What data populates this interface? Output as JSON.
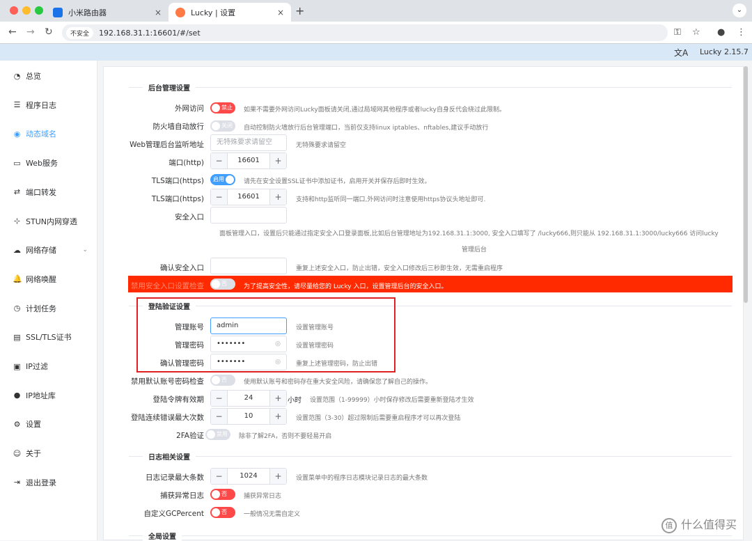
{
  "browser": {
    "tabs": [
      {
        "label": "小米路由器",
        "close": "×"
      },
      {
        "label": "Lucky | 设置",
        "close": "×"
      }
    ],
    "new_tab": "+",
    "expand": "⌄",
    "insecure": "不安全",
    "url": "192.168.31.1:16601/#/set"
  },
  "header": {
    "lang_icon": "文A",
    "version": "Lucky 2.15.7"
  },
  "sidebar": {
    "items": [
      {
        "label": "总览",
        "icon": "dashboard-icon"
      },
      {
        "label": "程序日志",
        "icon": "log-icon"
      },
      {
        "label": "动态域名",
        "icon": "ddns-icon"
      },
      {
        "label": "Web服务",
        "icon": "web-icon"
      },
      {
        "label": "端口转发",
        "icon": "port-forward-icon"
      },
      {
        "label": "STUN内网穿透",
        "icon": "stun-icon"
      },
      {
        "label": "网络存储",
        "icon": "cloud-icon"
      },
      {
        "label": "网络唤醒",
        "icon": "bell-icon"
      },
      {
        "label": "计划任务",
        "icon": "clock-icon"
      },
      {
        "label": "SSL/TLS证书",
        "icon": "cert-icon"
      },
      {
        "label": "IP过滤",
        "icon": "filter-icon"
      },
      {
        "label": "IP地址库",
        "icon": "user-icon"
      },
      {
        "label": "设置",
        "icon": "gear-icon"
      },
      {
        "label": "关于",
        "icon": "about-icon"
      },
      {
        "label": "退出登录",
        "icon": "logout-icon"
      }
    ]
  },
  "sections": {
    "admin": "后台管理设置",
    "login": "登陆验证设置",
    "log": "日志相关设置",
    "more": "全局设置"
  },
  "form": {
    "wan": {
      "label": "外网访问",
      "switch": "禁止",
      "hint": "如果不需要外网访问Lucky面板请关闭,通过局域网其他程序或者lucky自身反代会绕过此限制。"
    },
    "firewall": {
      "label": "防火墙自动放行",
      "switch": "关闭",
      "hint": "自动控制防火墙放行后台管理端口，当前仅支持linux iptables、nftables,建议手动放行"
    },
    "listen": {
      "label": "Web管理后台监听地址",
      "placeholder": "无特殊要求请留空",
      "hint": "无特殊要求请留空"
    },
    "http_port": {
      "label": "端口(http)",
      "value": "16601"
    },
    "tls_switch": {
      "label": "TLS端口(https)",
      "switch": "启用",
      "hint": "请先在安全设置SSL证书中添加证书，启用开关并保存后即时生效。"
    },
    "tls_port": {
      "label": "TLS端口(https)",
      "value": "16601",
      "hint": "支持和http监听同一端口,外网访问时注意使用https协议头地址即可."
    },
    "safe_entry": {
      "label": "安全入口",
      "hint1": "面板管理入口，设置后只能通过指定安全入口登录面板,比如后台管理地址为192.168.31.1:3000, 安全入口填写了 /lucky666,则只能从 192.168.31.1:3000/lucky666 访问lucky",
      "hint2": "管理后台"
    },
    "safe_confirm": {
      "label": "确认安全入口",
      "hint": "重复上述安全入口，防止出错，安全入口修改后三秒即生效，无需重启程序"
    },
    "safe_warn": {
      "label": "禁用安全入口设置检查",
      "switch": "否",
      "hint": "为了提高安全性，请尽量给您的 Lucky 入口，设置管理后台的安全入口。"
    },
    "account": {
      "label": "管理账号",
      "value": "admin",
      "hint": "设置管理账号"
    },
    "password": {
      "label": "管理密码",
      "value": "•••••••",
      "hint": "设置管理密码"
    },
    "password2": {
      "label": "确认管理密码",
      "value": "•••••••",
      "hint": "重复上述管理密码，防止出错"
    },
    "default_check": {
      "label": "禁用默认账号密码检查",
      "switch": "否",
      "hint": "使用默认账号和密码存在重大安全风险，请确保您了解自己的操作。"
    },
    "token": {
      "label": "登陆令牌有效期",
      "value": "24",
      "unit": "小时",
      "hint": "设置范围（1-99999）小时保存修改后需要重新登陆才生效"
    },
    "retry": {
      "label": "登陆连续错误最大次数",
      "value": "10",
      "hint": "设置范围（3-30）超过限制后需要重启程序才可以再次登陆"
    },
    "twofa": {
      "label": "2FA验证",
      "switch": "禁用",
      "hint": "除非了解2FA，否则不要轻易开启"
    },
    "log_max": {
      "label": "日志记录最大条数",
      "value": "1024",
      "hint": "设置菜单中的程序日志模块记录日志的最大条数"
    },
    "catch_log": {
      "label": "捕获异常日志",
      "switch": "否",
      "hint": "捕获异常日志"
    },
    "gc": {
      "label": "自定义GCPercent",
      "switch": "否",
      "hint": "一般情况无需自定义"
    }
  },
  "stepper": {
    "minus": "−",
    "plus": "+"
  },
  "watermark": {
    "icon": "值",
    "text": "什么值得买"
  },
  "colors": {
    "accent": "#409eff",
    "danger": "#ff4949",
    "warn_bar": "#ff2a00"
  }
}
